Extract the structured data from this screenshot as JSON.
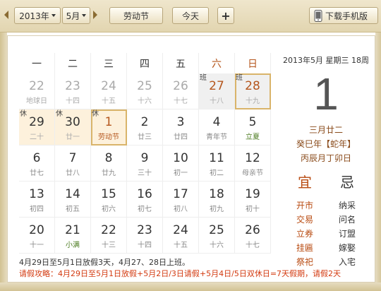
{
  "toolbar": {
    "year": "2013年",
    "month": "5月",
    "holiday_button": "劳动节",
    "today_button": "今天",
    "add_button": "+",
    "mobile_button": "下载手机版"
  },
  "weekdays": [
    "一",
    "二",
    "三",
    "四",
    "五",
    "六",
    "日"
  ],
  "days": [
    {
      "n": "22",
      "l": "地球日",
      "cur": false
    },
    {
      "n": "23",
      "l": "十四",
      "cur": false
    },
    {
      "n": "24",
      "l": "十五",
      "cur": false
    },
    {
      "n": "25",
      "l": "十六",
      "cur": false
    },
    {
      "n": "26",
      "l": "十七",
      "cur": false
    },
    {
      "n": "27",
      "l": "十八",
      "cur": false,
      "tag": "班",
      "work": true,
      "wk": true
    },
    {
      "n": "28",
      "l": "十九",
      "cur": false,
      "tag": "班",
      "work": true,
      "wk": true,
      "box": true
    },
    {
      "n": "29",
      "l": "二十",
      "cur": false,
      "tag": "休",
      "hol": true,
      "wk": true
    },
    {
      "n": "30",
      "l": "廿一",
      "cur": false,
      "tag": "休",
      "hol": true,
      "wk": true
    },
    {
      "n": "1",
      "l": "劳动节",
      "cur": true,
      "tag": "休",
      "hol": true,
      "sel": true
    },
    {
      "n": "2",
      "l": "廿三",
      "cur": true
    },
    {
      "n": "3",
      "l": "廿四",
      "cur": true
    },
    {
      "n": "4",
      "l": "青年节",
      "cur": true
    },
    {
      "n": "5",
      "l": "立夏",
      "cur": true,
      "lcolor": "#4a7a1e"
    },
    {
      "n": "6",
      "l": "廿七",
      "cur": true
    },
    {
      "n": "7",
      "l": "廿八",
      "cur": true
    },
    {
      "n": "8",
      "l": "廿九",
      "cur": true
    },
    {
      "n": "9",
      "l": "三十",
      "cur": true
    },
    {
      "n": "10",
      "l": "初一",
      "cur": true
    },
    {
      "n": "11",
      "l": "初二",
      "cur": true
    },
    {
      "n": "12",
      "l": "母亲节",
      "cur": true
    },
    {
      "n": "13",
      "l": "初四",
      "cur": true
    },
    {
      "n": "14",
      "l": "初五",
      "cur": true
    },
    {
      "n": "15",
      "l": "初六",
      "cur": true
    },
    {
      "n": "16",
      "l": "初七",
      "cur": true
    },
    {
      "n": "17",
      "l": "初八",
      "cur": true
    },
    {
      "n": "18",
      "l": "初九",
      "cur": true
    },
    {
      "n": "19",
      "l": "初十",
      "cur": true
    },
    {
      "n": "20",
      "l": "十一",
      "cur": true
    },
    {
      "n": "21",
      "l": "小满",
      "cur": true,
      "lcolor": "#4a7a1e"
    },
    {
      "n": "22",
      "l": "十三",
      "cur": true
    },
    {
      "n": "23",
      "l": "十四",
      "cur": true
    },
    {
      "n": "24",
      "l": "十五",
      "cur": true
    },
    {
      "n": "25",
      "l": "十六",
      "cur": true
    },
    {
      "n": "26",
      "l": "十七",
      "cur": true
    }
  ],
  "info": {
    "date_line": "2013年5月 星期三 18周",
    "big_day": "1",
    "lunar": "三月廿二",
    "ganzhi_year": "癸巳年【蛇年】",
    "ganzhi_mday": "丙辰月丁卯日",
    "yi_label": "宜",
    "ji_label": "忌",
    "yi": [
      "开市",
      "交易",
      "立券",
      "挂匾",
      "祭祀"
    ],
    "ji": [
      "纳采",
      "问名",
      "订盟",
      "嫁娶",
      "入宅"
    ]
  },
  "notes": {
    "line1": "4月29日至5月1日放假3天，4月27、28日上班。",
    "line2": "请假攻略：4月29日至5月1日放假+5月2日/3日请假+5月4日/5日双休日=7天假期，请假2天"
  },
  "colors": {
    "weekend_header": "#b5571e",
    "accent_red": "#d33a10",
    "lunar_brown": "#8a4b1b",
    "holiday_bg": "#fdf1dc"
  }
}
